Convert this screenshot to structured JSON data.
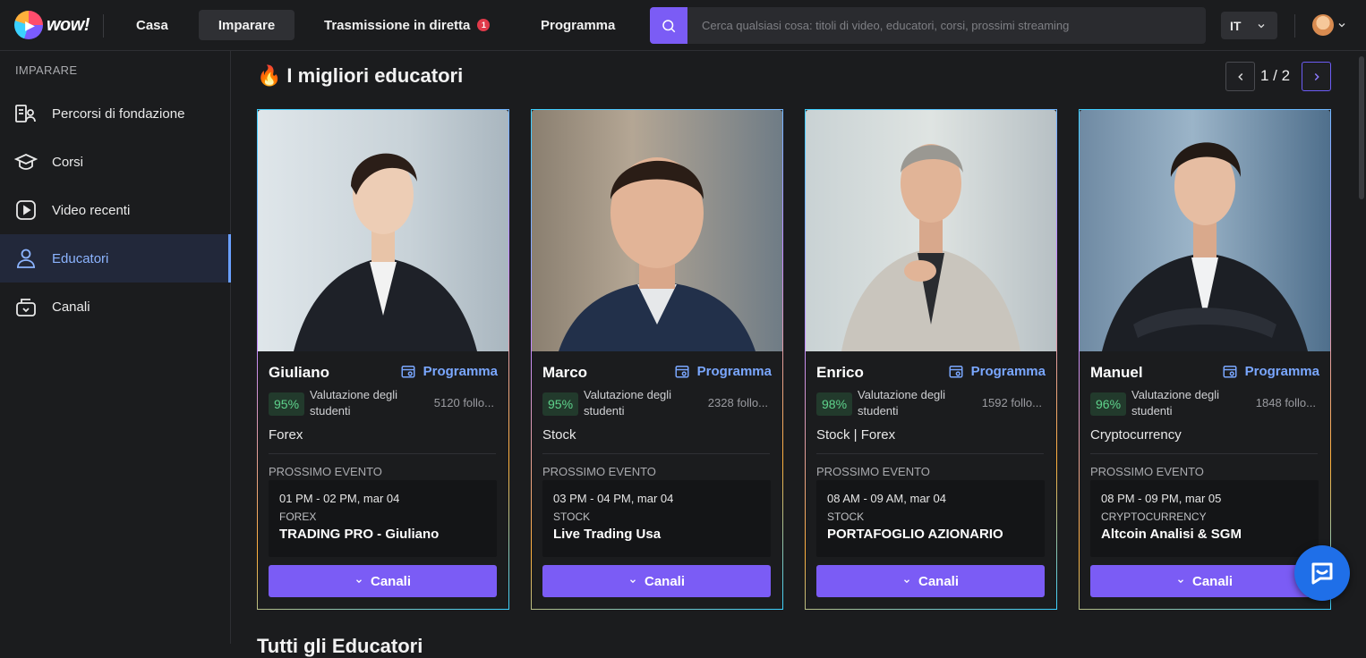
{
  "brand": {
    "logo_text": "wow!"
  },
  "nav": {
    "items": [
      {
        "label": "Casa"
      },
      {
        "label": "Imparare"
      },
      {
        "label": "Trasmissione in diretta",
        "badge": "1"
      },
      {
        "label": "Programma"
      }
    ]
  },
  "search": {
    "placeholder": "Cerca qualsiasi cosa: titoli di video, educatori, corsi, prossimi streaming"
  },
  "language": {
    "selected": "IT"
  },
  "sidebar": {
    "heading": "IMPARARE",
    "items": [
      {
        "label": "Percorsi di fondazione",
        "icon": "foundation-paths-icon"
      },
      {
        "label": "Corsi",
        "icon": "graduation-cap-icon"
      },
      {
        "label": "Video recenti",
        "icon": "play-video-icon"
      },
      {
        "label": "Educatori",
        "icon": "educator-icon",
        "active": true
      },
      {
        "label": "Canali",
        "icon": "channels-icon"
      }
    ]
  },
  "section": {
    "icon": "🔥",
    "title": "I migliori educatori",
    "pager": "1 / 2"
  },
  "educators": [
    {
      "name": "Giuliano",
      "schedule_label": "Programma",
      "rating": "95%",
      "rating_label": "Valutazione degli studenti",
      "followers": "5120 follo...",
      "category": "Forex",
      "next_label": "PROSSIMO EVENTO",
      "event": {
        "time": "01 PM - 02 PM, mar 04",
        "category": "FOREX",
        "title": "TRADING PRO - Giuliano"
      },
      "button": "Canali"
    },
    {
      "name": "Marco",
      "schedule_label": "Programma",
      "rating": "95%",
      "rating_label": "Valutazione degli studenti",
      "followers": "2328 follo...",
      "category": "Stock",
      "next_label": "PROSSIMO EVENTO",
      "event": {
        "time": "03 PM - 04 PM, mar 04",
        "category": "STOCK",
        "title": "Live Trading Usa"
      },
      "button": "Canali"
    },
    {
      "name": "Enrico",
      "schedule_label": "Programma",
      "rating": "98%",
      "rating_label": "Valutazione degli studenti",
      "followers": "1592 follo...",
      "category": "Stock | Forex",
      "next_label": "PROSSIMO EVENTO",
      "event": {
        "time": "08 AM - 09 AM, mar 04",
        "category": "STOCK",
        "title": "PORTAFOGLIO AZIONARIO"
      },
      "button": "Canali"
    },
    {
      "name": "Manuel",
      "schedule_label": "Programma",
      "rating": "96%",
      "rating_label": "Valutazione degli studenti",
      "followers": "1848 follo...",
      "category": "Cryptocurrency",
      "next_label": "PROSSIMO EVENTO",
      "event": {
        "time": "08 PM - 09 PM, mar 05",
        "category": "CRYPTOCURRENCY",
        "title": "Altcoin Analisi & SGM"
      },
      "button": "Canali"
    }
  ],
  "bottom_section": {
    "title": "Tutti gli Educatori"
  },
  "colors": {
    "accent": "#7b5cf5",
    "link": "#7aa7ff",
    "rating_green": "#5fd38c",
    "chat": "#1f6fe8"
  }
}
